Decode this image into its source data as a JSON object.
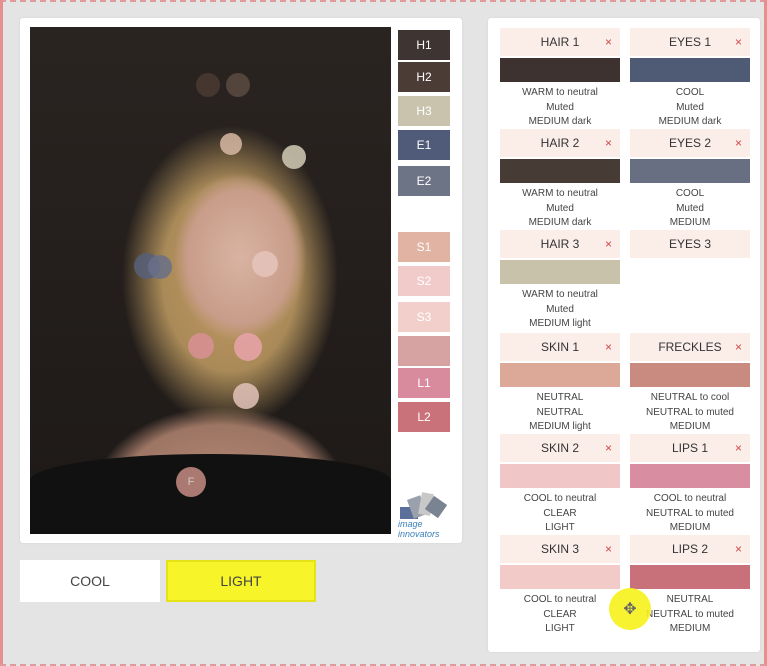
{
  "photo_markers": [
    {
      "label": "",
      "color": "#4a3a32"
    },
    {
      "label": "",
      "color": "#5a4a42"
    },
    {
      "label": "",
      "color": "#d7b8a3"
    },
    {
      "label": "",
      "color": "#d2cbb5"
    },
    {
      "label": "",
      "color": "#56607a"
    },
    {
      "label": "",
      "color": "#6a7088"
    },
    {
      "label": "",
      "color": "#e6c4bc"
    },
    {
      "label": "",
      "color": "#d88f95"
    },
    {
      "label": "",
      "color": "#e8a3aa"
    },
    {
      "label": "",
      "color": "#e3c3ba"
    },
    {
      "label": "F",
      "color": "#c58c82"
    }
  ],
  "swatches": [
    {
      "label": "H1",
      "color": "#3e3431"
    },
    {
      "label": "H2",
      "color": "#4b3d36"
    },
    {
      "label": "H3",
      "color": "#c9c3ad"
    },
    {
      "label": "E1",
      "color": "#4f5b78"
    },
    {
      "label": "E2",
      "color": "#6d7486"
    },
    {
      "label": "S1",
      "color": "#e0b3a3"
    },
    {
      "label": "S2",
      "color": "#f1cbca"
    },
    {
      "label": "S3",
      "color": "#f3cfcb"
    },
    {
      "label": "",
      "color": "#d7a3a2"
    },
    {
      "label": "L1",
      "color": "#d98b9e"
    },
    {
      "label": "L2",
      "color": "#c9727a"
    }
  ],
  "logo": {
    "text": "image innovators"
  },
  "buttons": {
    "cool": "COOL",
    "light": "LIGHT"
  },
  "remove_symbol": "×",
  "cells": [
    {
      "title": "HAIR 1",
      "removable": true,
      "color": "#3d3230",
      "lines": [
        "WARM to neutral",
        "Muted",
        "MEDIUM dark"
      ]
    },
    {
      "title": "EYES 1",
      "removable": true,
      "color": "#4f5b75",
      "lines": [
        "COOL",
        "Muted",
        "MEDIUM dark"
      ]
    },
    {
      "title": "HAIR 2",
      "removable": true,
      "color": "#473b35",
      "lines": [
        "WARM to neutral",
        "Muted",
        "MEDIUM dark"
      ]
    },
    {
      "title": "EYES 2",
      "removable": true,
      "color": "#696f82",
      "lines": [
        "COOL",
        "Muted",
        "MEDIUM"
      ]
    },
    {
      "title": "HAIR 3",
      "removable": true,
      "color": "#c8c2aa",
      "lines": [
        "WARM to neutral",
        "Muted",
        "MEDIUM light"
      ]
    },
    {
      "title": "EYES 3",
      "removable": false,
      "color": "",
      "lines": []
    },
    {
      "title": "SKIN 1",
      "removable": true,
      "color": "#dca999",
      "lines": [
        "NEUTRAL",
        "NEUTRAL",
        "MEDIUM light"
      ]
    },
    {
      "title": "FRECKLES",
      "removable": true,
      "color": "#c98a80",
      "lines": [
        "NEUTRAL to cool",
        "NEUTRAL to muted",
        "MEDIUM"
      ]
    },
    {
      "title": "SKIN 2",
      "removable": true,
      "color": "#f1c6c6",
      "lines": [
        "COOL to neutral",
        "CLEAR",
        "LIGHT"
      ]
    },
    {
      "title": "LIPS 1",
      "removable": true,
      "color": "#d98da0",
      "lines": [
        "COOL to neutral",
        "NEUTRAL to muted",
        "MEDIUM"
      ]
    },
    {
      "title": "SKIN 3",
      "removable": true,
      "color": "#f2cac8",
      "lines": [
        "COOL to neutral",
        "CLEAR",
        "LIGHT"
      ]
    },
    {
      "title": "LIPS 2",
      "removable": true,
      "color": "#c8717a",
      "lines": [
        "NEUTRAL",
        "NEUTRAL to muted",
        "MEDIUM"
      ]
    }
  ],
  "cursor_icon": "move-cursor-icon"
}
